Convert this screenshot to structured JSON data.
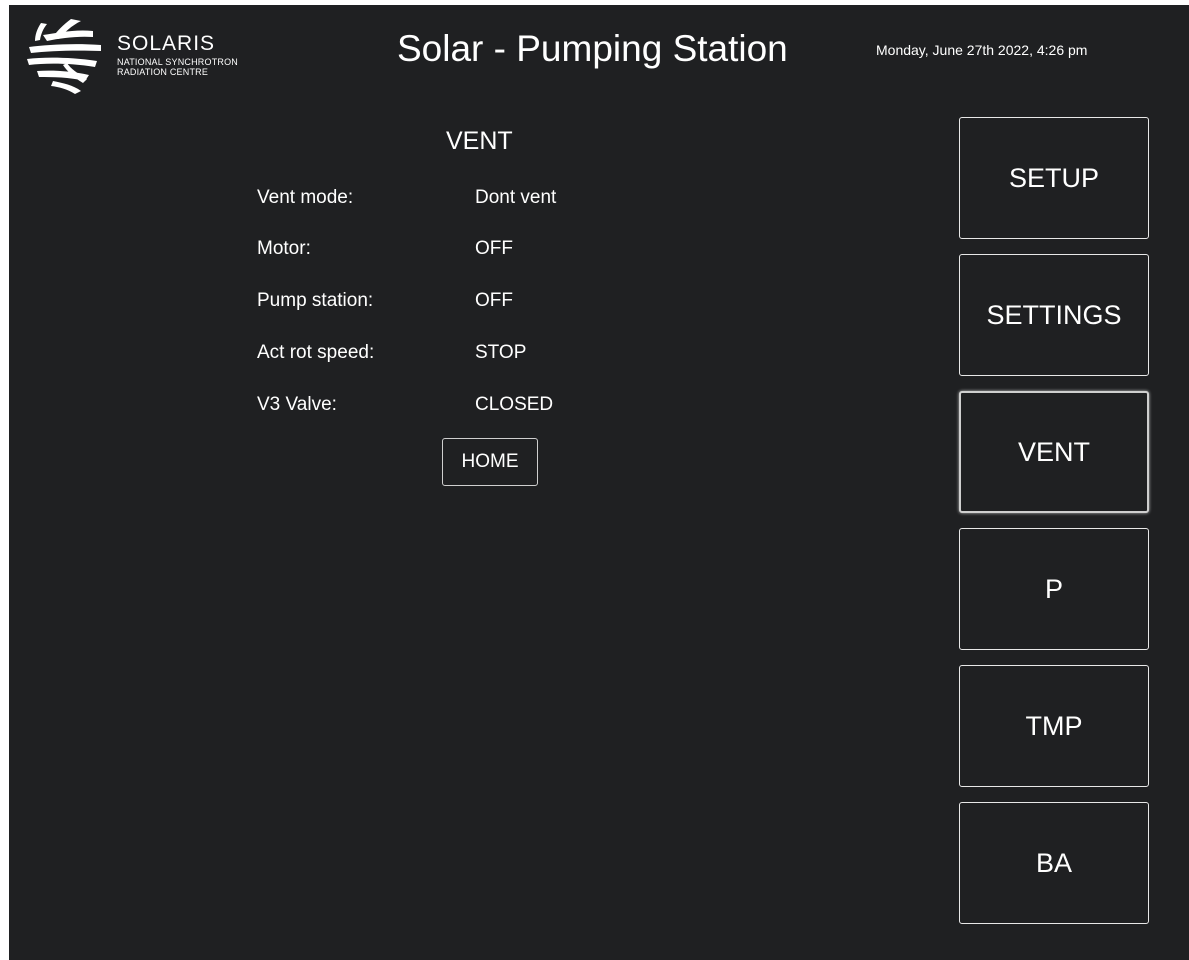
{
  "header": {
    "logo": {
      "name": "SOLARIS",
      "subtitle_line1": "NATIONAL SYNCHROTRON",
      "subtitle_line2": "RADIATION CENTRE"
    },
    "title": "Solar - Pumping Station",
    "datetime": "Monday, June 27th 2022, 4:26 pm"
  },
  "panel": {
    "title": "VENT",
    "rows": [
      {
        "label": "Vent mode:",
        "value": "Dont vent"
      },
      {
        "label": "Motor:",
        "value": "OFF"
      },
      {
        "label": "Pump station:",
        "value": "OFF"
      },
      {
        "label": "Act rot speed:",
        "value": "STOP"
      },
      {
        "label": "V3 Valve:",
        "value": "CLOSED"
      }
    ],
    "home_label": "HOME"
  },
  "nav": {
    "active": "VENT",
    "items": [
      {
        "label": "SETUP"
      },
      {
        "label": "SETTINGS"
      },
      {
        "label": "VENT"
      },
      {
        "label": "P"
      },
      {
        "label": "TMP"
      },
      {
        "label": "BA"
      }
    ]
  },
  "colors": {
    "background": "#1f2022",
    "text": "#ffffff",
    "button_border": "#e8e8e8"
  }
}
